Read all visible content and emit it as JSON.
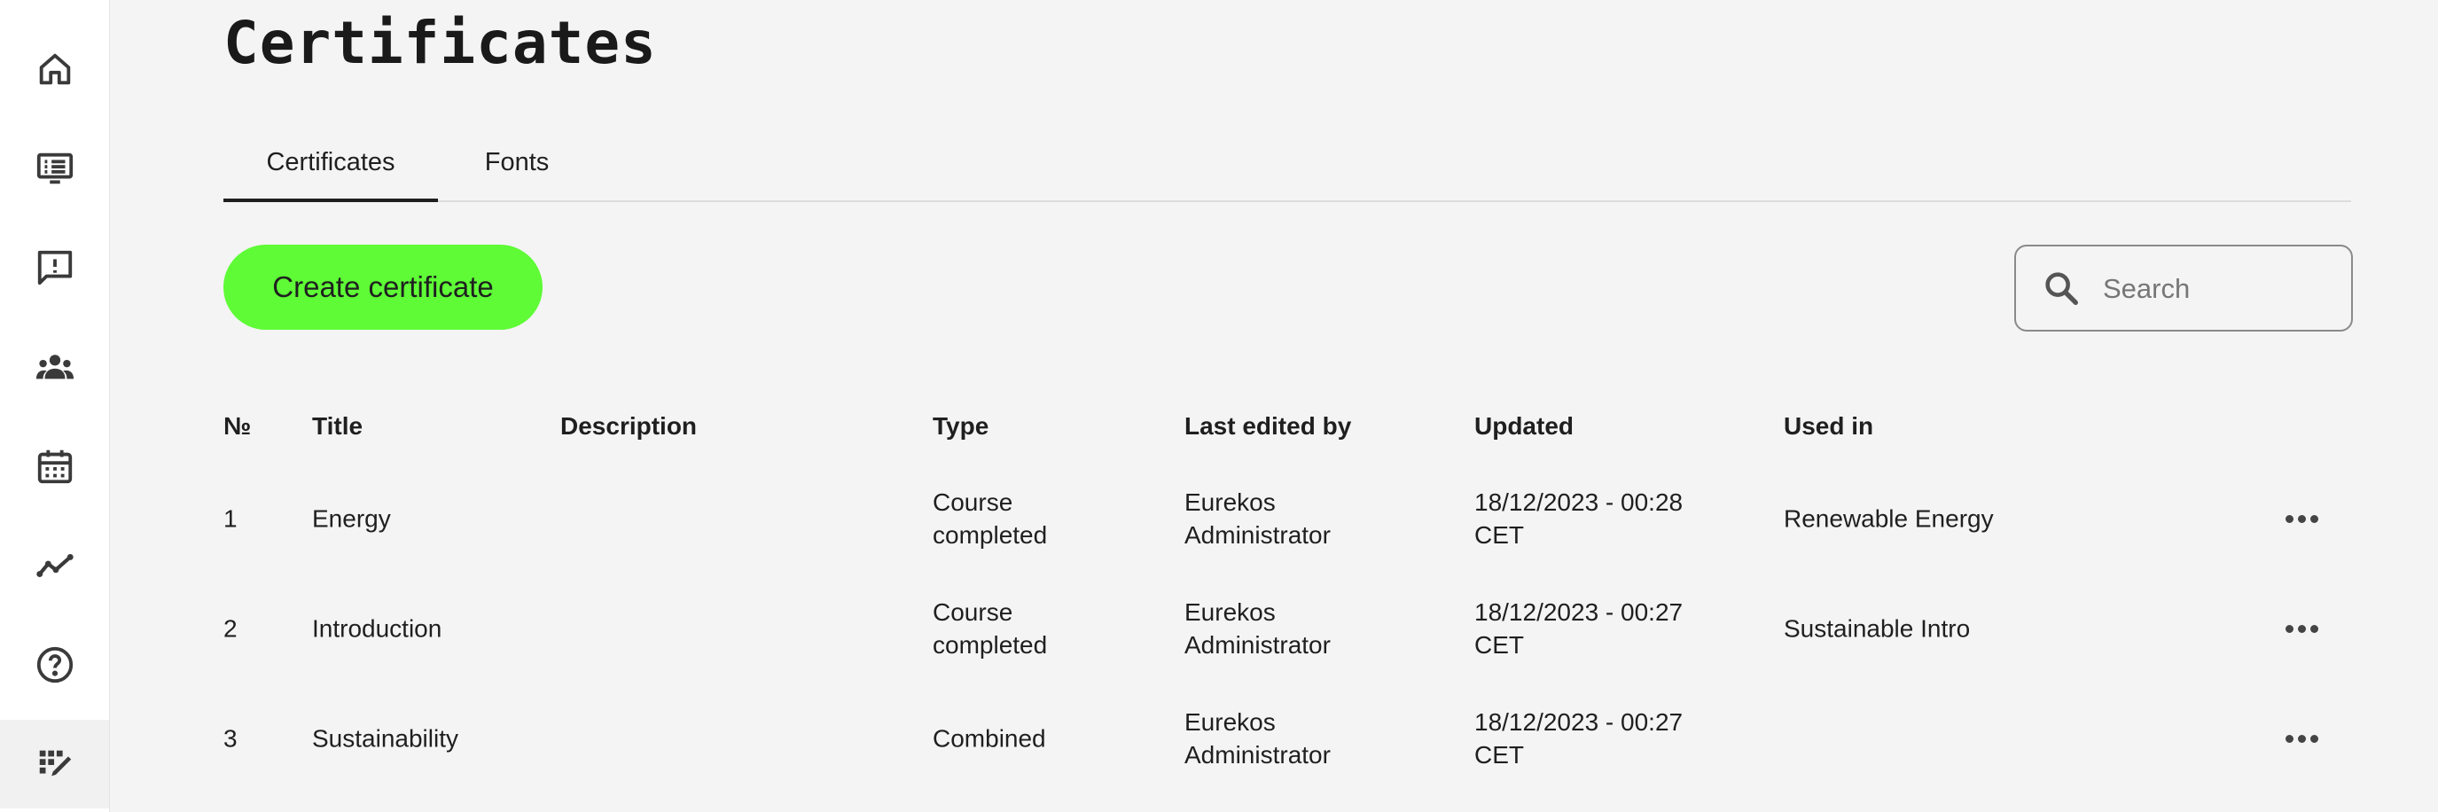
{
  "sidebar": {
    "items": [
      {
        "icon": "home-icon"
      },
      {
        "icon": "course-list-icon"
      },
      {
        "icon": "feedback-icon"
      },
      {
        "icon": "users-group-icon"
      },
      {
        "icon": "calendar-icon"
      },
      {
        "icon": "analytics-icon"
      },
      {
        "icon": "help-icon"
      },
      {
        "icon": "certificate-design-icon",
        "active": true
      }
    ]
  },
  "page": {
    "title": "Certificates"
  },
  "tabs": [
    {
      "label": "Certificates",
      "active": true
    },
    {
      "label": "Fonts",
      "active": false
    }
  ],
  "toolbar": {
    "create_label": "Create certificate",
    "search_placeholder": "Search",
    "search_value": ""
  },
  "table": {
    "headers": {
      "number": "№",
      "title": "Title",
      "description": "Description",
      "type": "Type",
      "last_edited_by": "Last edited by",
      "updated": "Updated",
      "used_in": "Used in"
    },
    "rows": [
      {
        "number": "1",
        "title": "Energy",
        "description": "",
        "type_line1": "Course",
        "type_line2": "completed",
        "editor_line1": "Eurekos",
        "editor_line2": "Administrator",
        "updated_line1": "18/12/2023 - 00:28",
        "updated_line2": "CET",
        "used_in": "Renewable Energy"
      },
      {
        "number": "2",
        "title": "Introduction",
        "description": "",
        "type_line1": "Course",
        "type_line2": "completed",
        "editor_line1": "Eurekos",
        "editor_line2": "Administrator",
        "updated_line1": "18/12/2023 - 00:27",
        "updated_line2": "CET",
        "used_in": "Sustainable Intro"
      },
      {
        "number": "3",
        "title": "Sustainability",
        "description": "",
        "type_line1": "Combined",
        "type_line2": "",
        "editor_line1": "Eurekos",
        "editor_line2": "Administrator",
        "updated_line1": "18/12/2023 - 00:27",
        "updated_line2": "CET",
        "used_in": ""
      }
    ]
  },
  "colors": {
    "accent": "#5efb36",
    "background": "#f4f4f4",
    "sidebar": "#ffffff",
    "text": "#1f1f1f"
  }
}
